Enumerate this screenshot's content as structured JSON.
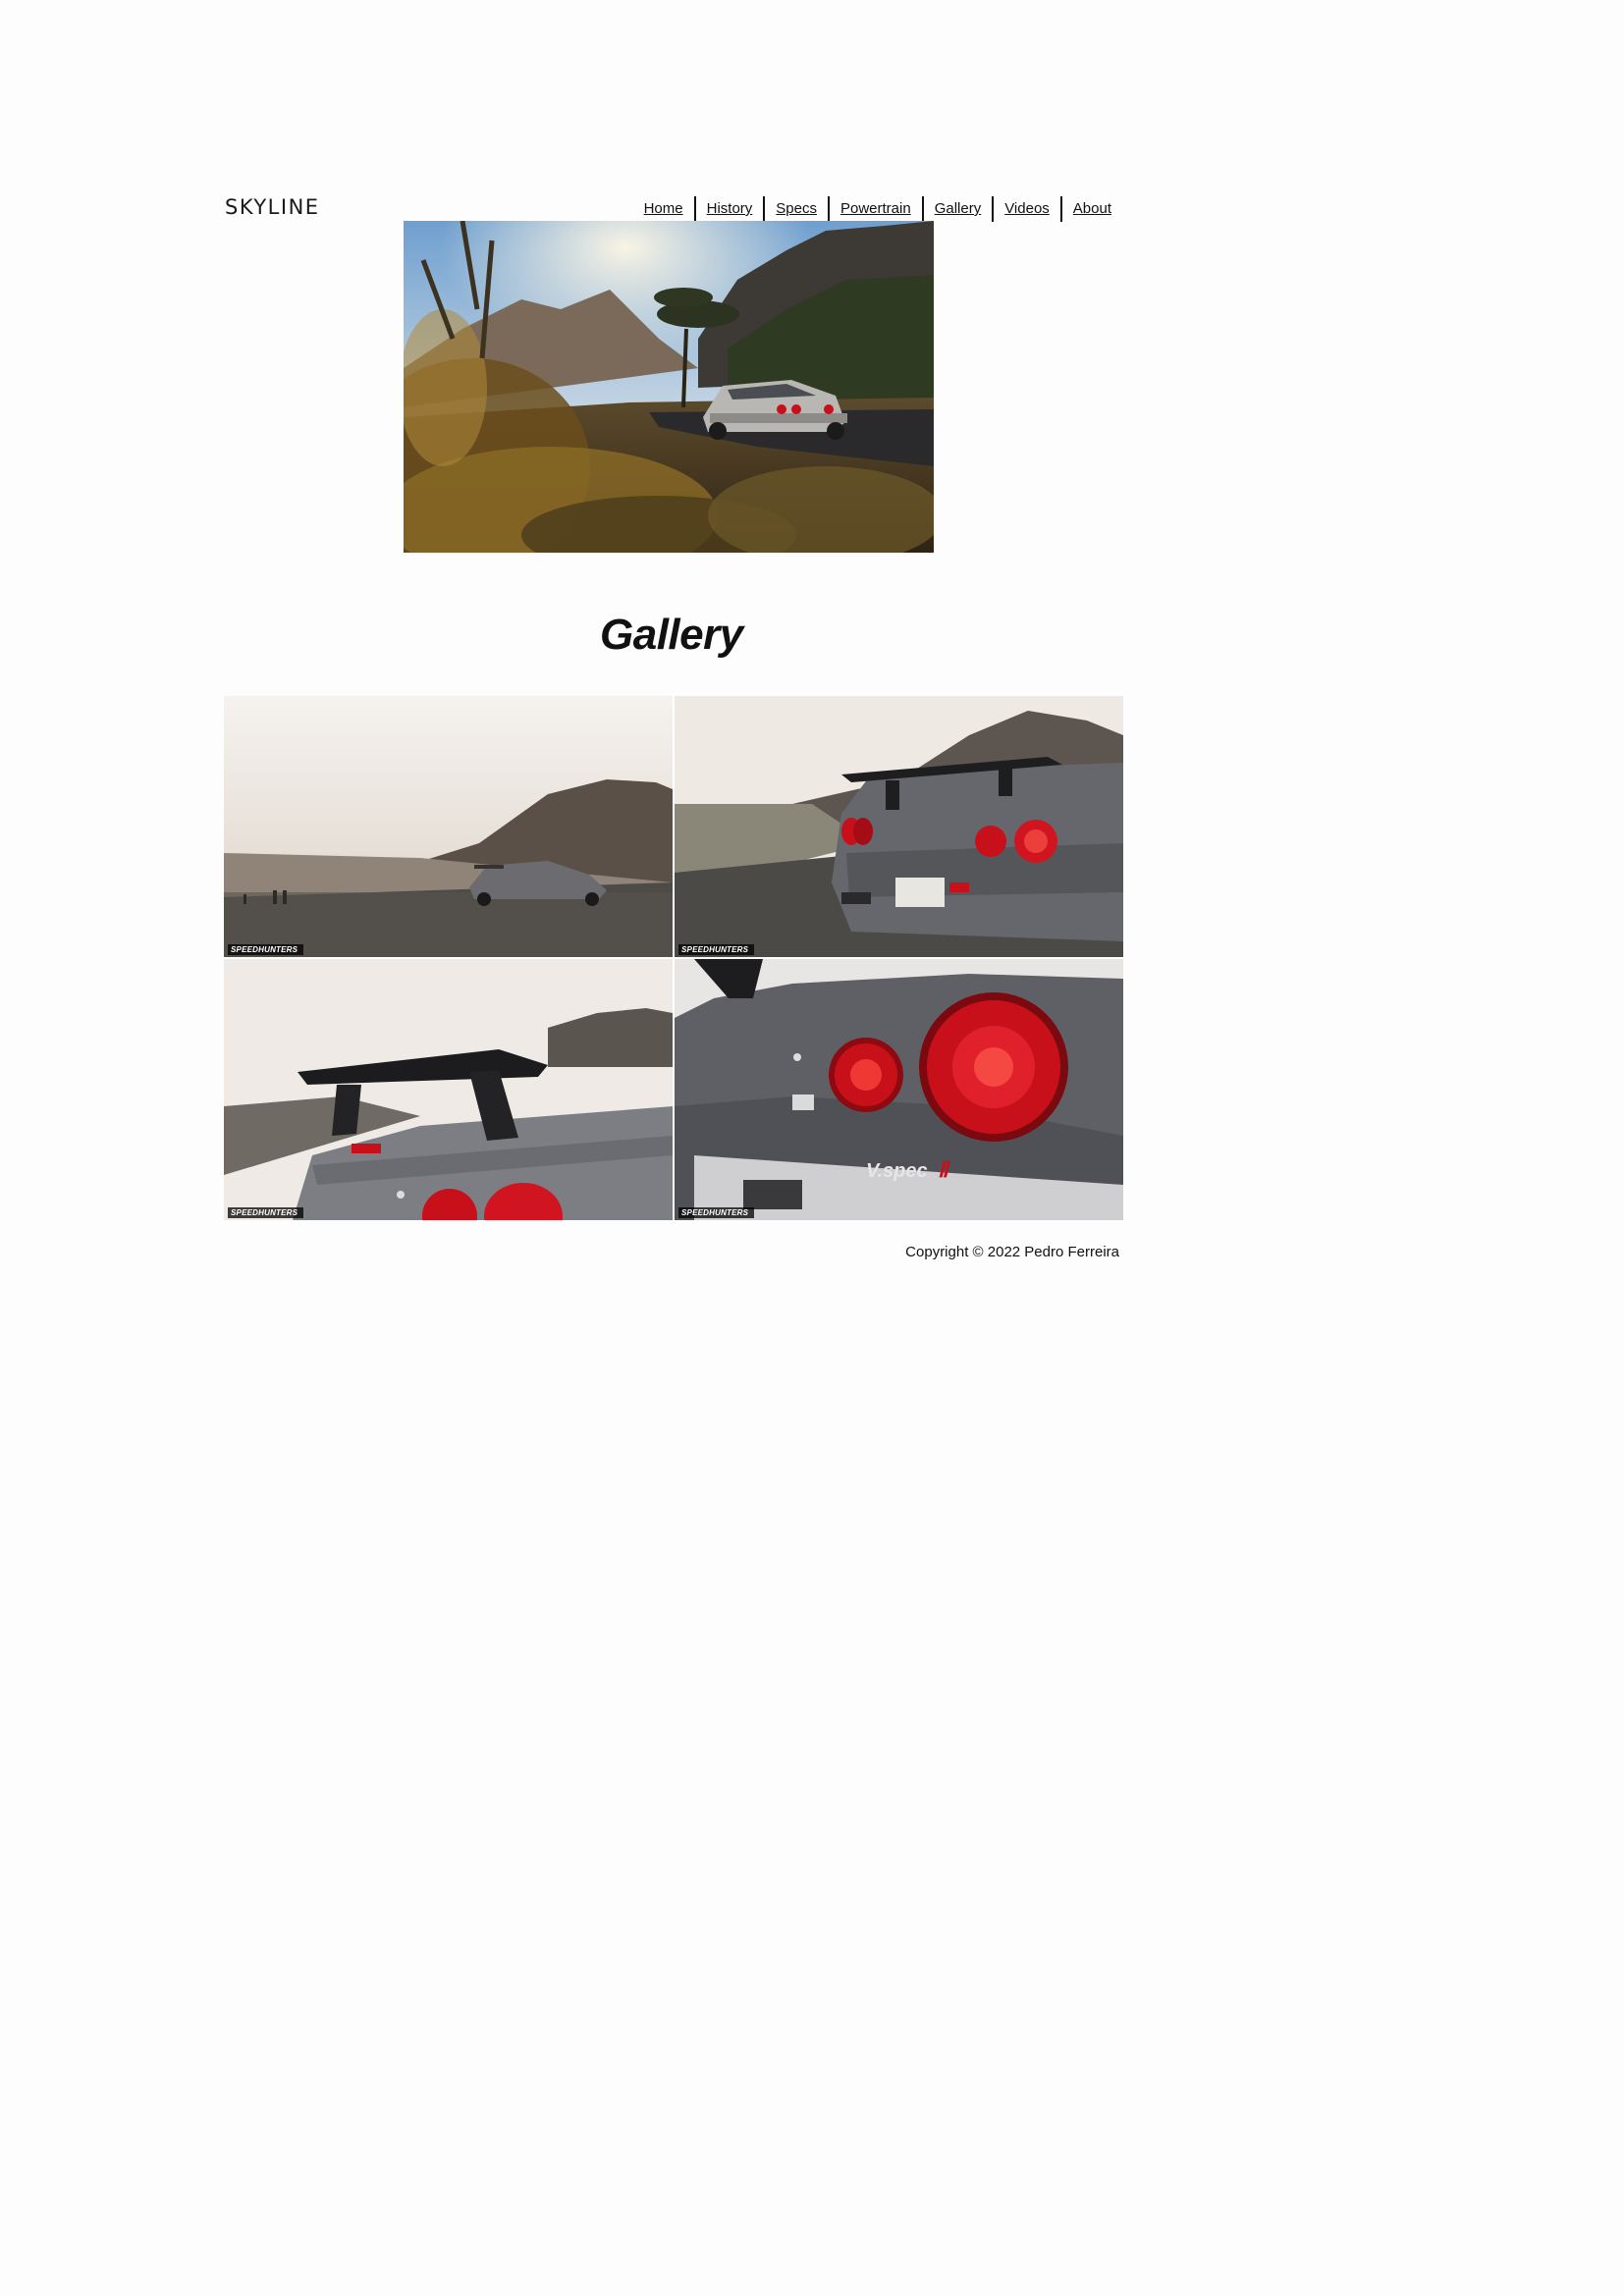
{
  "header": {
    "logo": "SKYLINE"
  },
  "nav": {
    "items": [
      {
        "label": "Home"
      },
      {
        "label": "History"
      },
      {
        "label": "Specs"
      },
      {
        "label": "Powertrain"
      },
      {
        "label": "Gallery"
      },
      {
        "label": "Videos"
      },
      {
        "label": "About"
      }
    ]
  },
  "hero": {
    "image": "photo of silver skyline car on mountain road at sunset"
  },
  "main": {
    "title": "Gallery"
  },
  "gallery": {
    "watermark": "SPEEDHUNTERS",
    "tiles": [
      {
        "image": "car parked at mountain overlook"
      },
      {
        "image": "rear view with wing and taillights"
      },
      {
        "image": "rear wing close-up"
      },
      {
        "image": "taillight close-up with V-spec badge"
      }
    ]
  },
  "footer": {
    "copyright": "Copyright © 2022 Pedro Ferreira"
  },
  "colors": {
    "background": "#fdfdfd",
    "text": "#111111",
    "taillight": "#c8101a"
  }
}
